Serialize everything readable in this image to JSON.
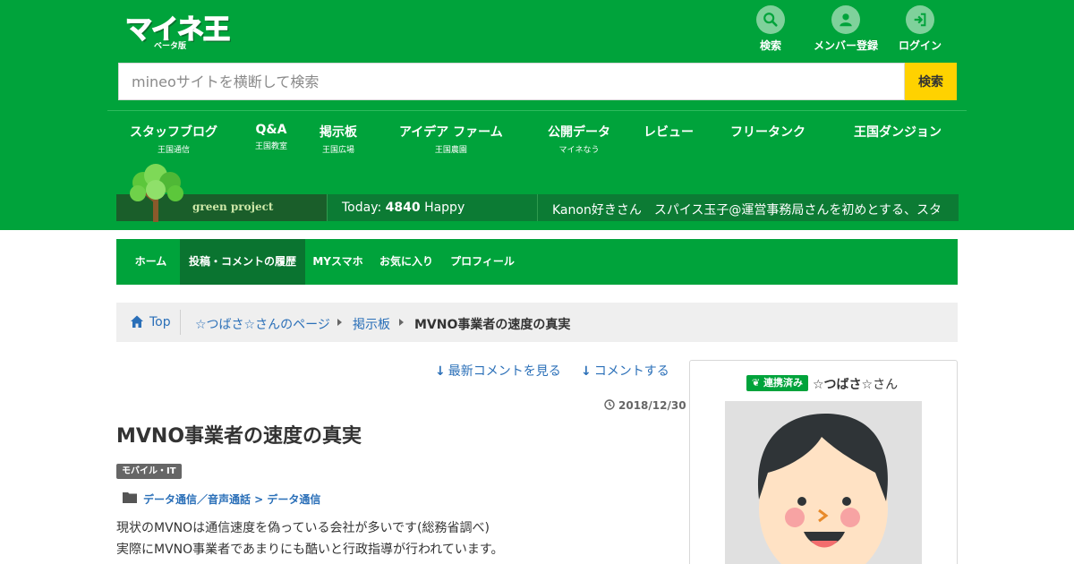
{
  "logo": {
    "text_parts": [
      "マ",
      "イ",
      "ネ",
      "王"
    ],
    "beta": "ベータ版"
  },
  "top_nav": [
    {
      "label": "検索",
      "icon": "search-icon"
    },
    {
      "label": "メンバー登録",
      "icon": "user-icon"
    },
    {
      "label": "ログイン",
      "icon": "login-icon"
    }
  ],
  "search": {
    "placeholder": "mineoサイトを横断して検索",
    "button_label": "検索"
  },
  "main_nav": [
    {
      "label": "スタッフブログ",
      "sub": "王国通信"
    },
    {
      "label": "Q&A",
      "sub": "王国教室"
    },
    {
      "label": "掲示板",
      "sub": "王国広場"
    },
    {
      "label": "アイデア ファーム",
      "sub": "王国農園"
    },
    {
      "label": "公開データ",
      "sub": "マイネなう"
    },
    {
      "label": "レビュー",
      "sub": ""
    },
    {
      "label": "フリータンク",
      "sub": ""
    },
    {
      "label": "王国ダンジョン",
      "sub": ""
    }
  ],
  "green_project": {
    "banner_text": "green project",
    "today_prefix": "Today:",
    "today_count": "4840",
    "today_suffix": "Happy",
    "ticker": "Kanon好きさん　スパイス玉子@運営事務局さんを初めとする、スタ"
  },
  "user_nav": [
    {
      "label": "ホーム",
      "active": false
    },
    {
      "label": "投稿・コメントの履歴",
      "active": true
    },
    {
      "label": "MYスマホ",
      "active": false
    },
    {
      "label": "お気に入り",
      "active": false
    },
    {
      "label": "プロフィール",
      "active": false
    }
  ],
  "breadcrumb": {
    "top": "Top",
    "items": [
      "☆つばさ☆さんのページ",
      "掲示板"
    ],
    "current": "MVNO事業者の速度の真実"
  },
  "article": {
    "link_latest": "最新コメントを見る",
    "link_comment": "コメントする",
    "date": "2018/12/30",
    "title": "MVNO事業者の速度の真実",
    "tag": "モバイル・IT",
    "category": "データ通信／音声通話 > データ通信",
    "body": [
      "現状のMVNOは通信速度を偽っている会社が多いです(総務省調べ)",
      "実際にMVNO事業者であまりにも酷いと行政指導が行われています。"
    ]
  },
  "profile": {
    "badge": "連携済み",
    "name": "☆つばさ☆",
    "suffix": "さん"
  },
  "colors": {
    "brand_green": "#00a33b",
    "active_tab": "#0a7430",
    "search_button": "#ffd200",
    "link": "#2a6fb8"
  }
}
